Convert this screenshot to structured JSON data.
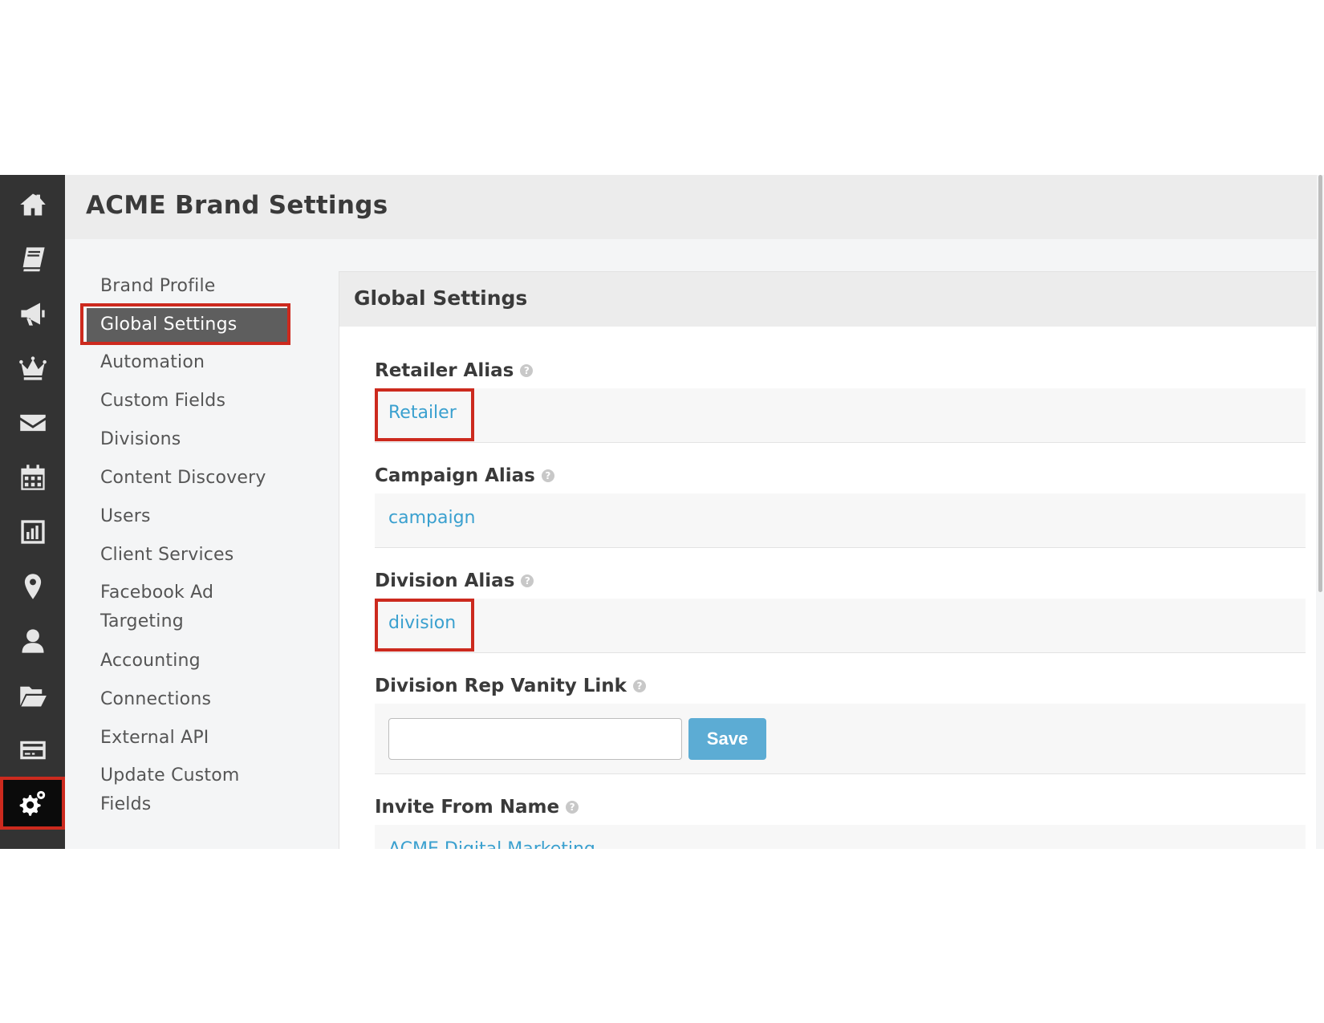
{
  "page": {
    "title": "ACME Brand Settings"
  },
  "rail": {
    "items": [
      {
        "icon": "home-icon"
      },
      {
        "icon": "book-icon"
      },
      {
        "icon": "megaphone-icon"
      },
      {
        "icon": "crown-icon"
      },
      {
        "icon": "envelope-icon"
      },
      {
        "icon": "calendar-icon"
      },
      {
        "icon": "bar-chart-icon"
      },
      {
        "icon": "map-pin-icon"
      },
      {
        "icon": "user-icon"
      },
      {
        "icon": "folder-open-icon"
      },
      {
        "icon": "credit-card-icon"
      },
      {
        "icon": "gears-icon",
        "active": true
      }
    ]
  },
  "settings_nav": {
    "items": [
      {
        "label": "Brand Profile"
      },
      {
        "label": "Global Settings",
        "active": true
      },
      {
        "label": "Automation"
      },
      {
        "label": "Custom Fields"
      },
      {
        "label": "Divisions"
      },
      {
        "label": "Content Discovery"
      },
      {
        "label": "Users"
      },
      {
        "label": "Client Services"
      },
      {
        "label": "Facebook Ad Targeting"
      },
      {
        "label": "Accounting"
      },
      {
        "label": "Connections"
      },
      {
        "label": "External API"
      },
      {
        "label": "Update Custom Fields"
      }
    ]
  },
  "panel": {
    "title": "Global Settings",
    "retailer_alias": {
      "label": "Retailer Alias",
      "value": "Retailer"
    },
    "campaign_alias": {
      "label": "Campaign Alias",
      "value": "campaign"
    },
    "division_alias": {
      "label": "Division Alias",
      "value": "division"
    },
    "vanity_link": {
      "label": "Division Rep Vanity Link",
      "value": "",
      "save_label": "Save"
    },
    "invite_from_name": {
      "label": "Invite From Name",
      "value": "ACME Digital Marketing"
    },
    "help_glyph": "?"
  },
  "colors": {
    "rail_bg": "#333333",
    "highlight": "#cc2a1e",
    "link": "#3aa0cf",
    "save_button": "#5cacd4"
  }
}
